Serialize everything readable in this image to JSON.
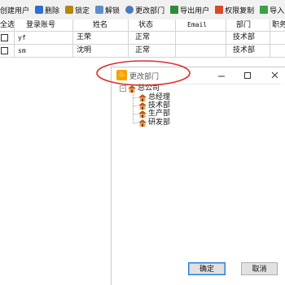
{
  "toolbar": {
    "items": [
      {
        "label": "创建用户"
      },
      {
        "label": "删除"
      },
      {
        "label": "锁定"
      },
      {
        "label": "解锁"
      },
      {
        "label": "更改部门"
      },
      {
        "label": "导出用户"
      },
      {
        "label": "权限复制"
      },
      {
        "label": "导入"
      }
    ]
  },
  "grid": {
    "headers": {
      "select": "全选",
      "login": "登录账号",
      "name": "姓名",
      "status": "状态",
      "email": "Email",
      "dept": "部门",
      "extra": "职务"
    },
    "rows": [
      {
        "login": "yf",
        "name": "王荣",
        "status": "正常",
        "email": "",
        "dept": "技术部",
        "extra": ""
      },
      {
        "login": "sm",
        "name": "沈明",
        "status": "正常",
        "email": "",
        "dept": "技术部",
        "extra": ""
      }
    ]
  },
  "dialog": {
    "title": "更改部门",
    "app_icon_glyph": "♨",
    "tree": {
      "root": "总公司",
      "children": [
        "总经理",
        "技术部",
        "生产部",
        "研发部"
      ]
    },
    "ok_label": "确定",
    "cancel_label": "取消"
  },
  "colors": {
    "annotation": "#d9302f",
    "ok_border": "#2f7bd6",
    "app_icon": "#f5a300"
  }
}
